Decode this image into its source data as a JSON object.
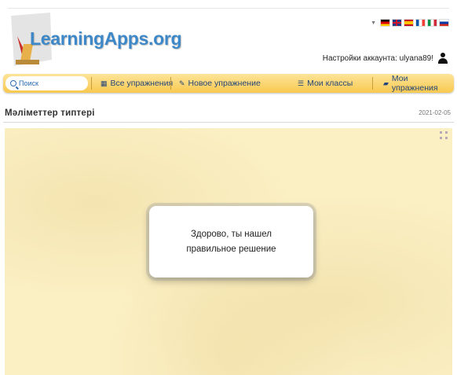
{
  "logo": {
    "text": "LearningApps.org"
  },
  "languages": [
    "de",
    "gb",
    "es",
    "fr",
    "it",
    "ru"
  ],
  "account": {
    "label": "Настройки аккаунта: ulyana89!"
  },
  "nav": {
    "search_placeholder": "Поиск",
    "all_exercises": "Все упражнения",
    "new_exercise": "Новое упражнение",
    "my_classes": "Мои классы",
    "my_exercises": "Мои упражнения"
  },
  "page": {
    "title": "Мәліметтер типтері",
    "date": "2021-02-05"
  },
  "dialog": {
    "message": "Здорово, ты нашел правильное решение"
  },
  "colors": {
    "brand_blue": "#3d88c8",
    "navbar_yellow": "#f8c94f",
    "app_background": "#fbf0c4"
  },
  "icons": {
    "search": "search-icon",
    "all_exercises": "grid-icon",
    "new_exercise": "pencil-icon",
    "my_classes": "list-icon",
    "my_exercises": "folder-icon",
    "account": "user-icon",
    "fullscreen": "expand-icon"
  }
}
